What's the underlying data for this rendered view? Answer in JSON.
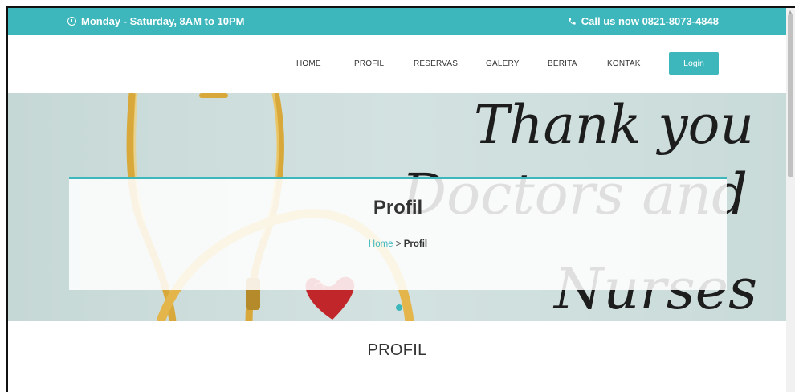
{
  "topbar": {
    "hours": "Monday - Saturday, 8AM to 10PM",
    "phone": "Call us now 0821-8073-4848",
    "background": "#3eb7bc"
  },
  "nav": {
    "items": [
      "HOME",
      "PROFIL",
      "RESERVASI",
      "GALERY",
      "BERITA",
      "KONTAK"
    ],
    "login": "Login"
  },
  "hero": {
    "title": "Profil",
    "breadcrumb_home": "Home",
    "breadcrumb_separator": ">",
    "breadcrumb_current": "Profil",
    "handwriting": [
      "Thank you",
      "Doctors and",
      "Nurses"
    ]
  },
  "section": {
    "title": "PROFIL"
  },
  "colors": {
    "accent": "#3eb7bc",
    "text": "#333333"
  }
}
